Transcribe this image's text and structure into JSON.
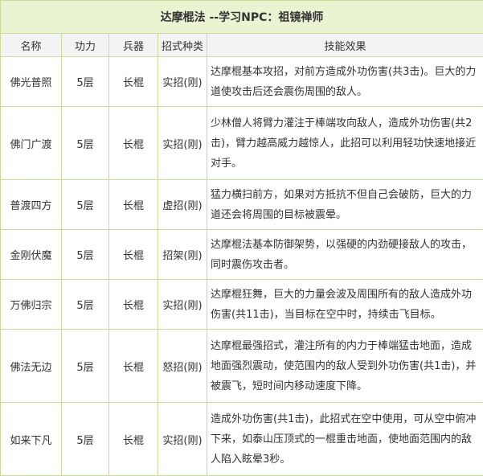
{
  "title": "达摩棍法 --学习NPC：祖镜禅师",
  "headers": [
    "名称",
    "功力",
    "兵器",
    "招式种类",
    "技能效果"
  ],
  "rows": [
    {
      "name": "佛光普照",
      "power": "5层",
      "weapon": "长棍",
      "type": "实招(刚)",
      "effect": "达摩棍基本攻招，对前方造成外功伤害(共3击)。巨大的力道使攻击后还会震伤周围的敌人。"
    },
    {
      "name": "佛门广渡",
      "power": "5层",
      "weapon": "长棍",
      "type": "实招(刚)",
      "effect": "少林僧人将臂力灌注于棒端攻向敌人，造成外功伤害(共2击)，臂力越高威力越惊人，此招可以利用轻功快速地接近对手。"
    },
    {
      "name": "普渡四方",
      "power": "5层",
      "weapon": "长棍",
      "type": "虚招(刚)",
      "effect": "猛力横扫前方，如果对方抵抗不但自己会破防，巨大的力道还会将周围的目标被震晕。"
    },
    {
      "name": "金刚伏魔",
      "power": "5层",
      "weapon": "长棍",
      "type": "招架(刚)",
      "effect": "达摩棍法基本防御架势，以强硬的内劲硬接敌人的攻击，同时震伤攻击者。"
    },
    {
      "name": "万佛归宗",
      "power": "5层",
      "weapon": "长棍",
      "type": "实招(刚)",
      "effect": "达摩棍狂舞，巨大的力量会波及周围所有的敌人造成外功伤害(共11击)，当目标在空中时，持续击飞目标。"
    },
    {
      "name": "佛法无边",
      "power": "5层",
      "weapon": "长棍",
      "type": "怒招(刚)",
      "effect": "达摩棍最强招式，灌注所有的内力于棒端猛击地面，造成地面强烈震动，使范围内的敌人受到外功伤害(共1击)，并被震飞，短时间内移动速度下降。"
    },
    {
      "name": "如来下凡",
      "power": "5层",
      "weapon": "长棍",
      "type": "实招(刚)",
      "effect": "造成外功伤害(共1击)，此招式在空中使用，可从空中俯冲下来，如泰山压顶式的一棍重击地面，使地面范围内的敌人陷入眩晕3秒。"
    }
  ]
}
